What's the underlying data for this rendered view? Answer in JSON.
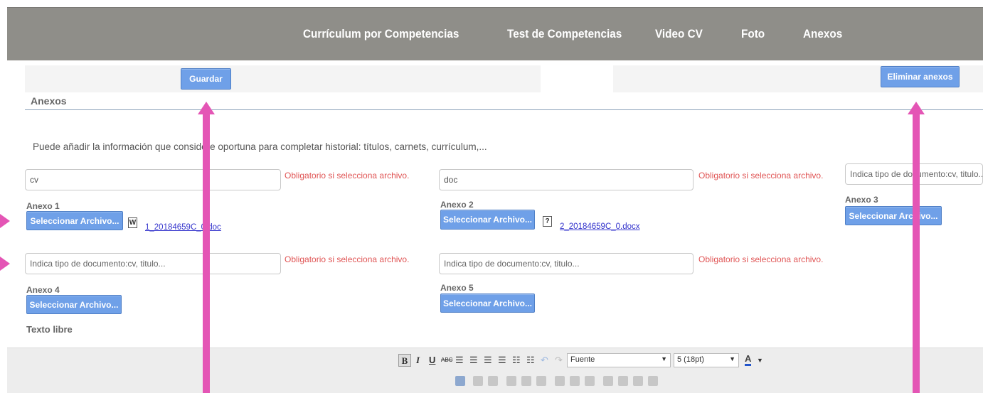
{
  "nav": {
    "tabs": [
      "Currículum por Competencias",
      "Test de Competencias",
      "Video CV",
      "Foto",
      "Anexos"
    ]
  },
  "toolbar": {
    "save_label": "Guardar",
    "delete_label": "Eliminar anexos"
  },
  "section": {
    "title": "Anexos",
    "intro": "Puede añadir la información que considere oportuna para completar historial: títulos, carnets, currículum,..."
  },
  "annexes": [
    {
      "label": "Anexo 1",
      "value": "cv",
      "placeholder": "Indica tipo de documento:cv, titulo...",
      "required_text": "Obligatorio si selecciona archivo.",
      "button": "Seleccionar Archivo...",
      "file": "1_20184659C_0.doc"
    },
    {
      "label": "Anexo 2",
      "value": "doc",
      "placeholder": "Indica tipo de documento:cv, titulo...",
      "required_text": "Obligatorio si selecciona archivo.",
      "button": "Seleccionar Archivo...",
      "file": "2_20184659C_0.docx"
    },
    {
      "label": "Anexo 3",
      "value": "",
      "placeholder": "Indica tipo de documento:cv, titulo...",
      "required_text": "",
      "button": "Seleccionar Archivo...",
      "file": ""
    },
    {
      "label": "Anexo 4",
      "value": "",
      "placeholder": "Indica tipo de documento:cv, titulo...",
      "required_text": "Obligatorio si selecciona archivo.",
      "button": "Seleccionar Archivo...",
      "file": ""
    },
    {
      "label": "Anexo 5",
      "value": "",
      "placeholder": "Indica tipo de documento:cv, titulo...",
      "required_text": "Obligatorio si selecciona archivo.",
      "button": "Seleccionar Archivo...",
      "file": ""
    }
  ],
  "free_text_label": "Texto libre",
  "editor": {
    "font_select": "Fuente",
    "size_select": "5 (18pt)",
    "bold": "B",
    "italic": "I",
    "underline": "U",
    "strike": "ABC",
    "font_color": "A"
  },
  "colors": {
    "nav_bg": "#8f8e89",
    "button": "#6fa0e8",
    "required": "#e05555",
    "arrow": "#e455b5"
  }
}
